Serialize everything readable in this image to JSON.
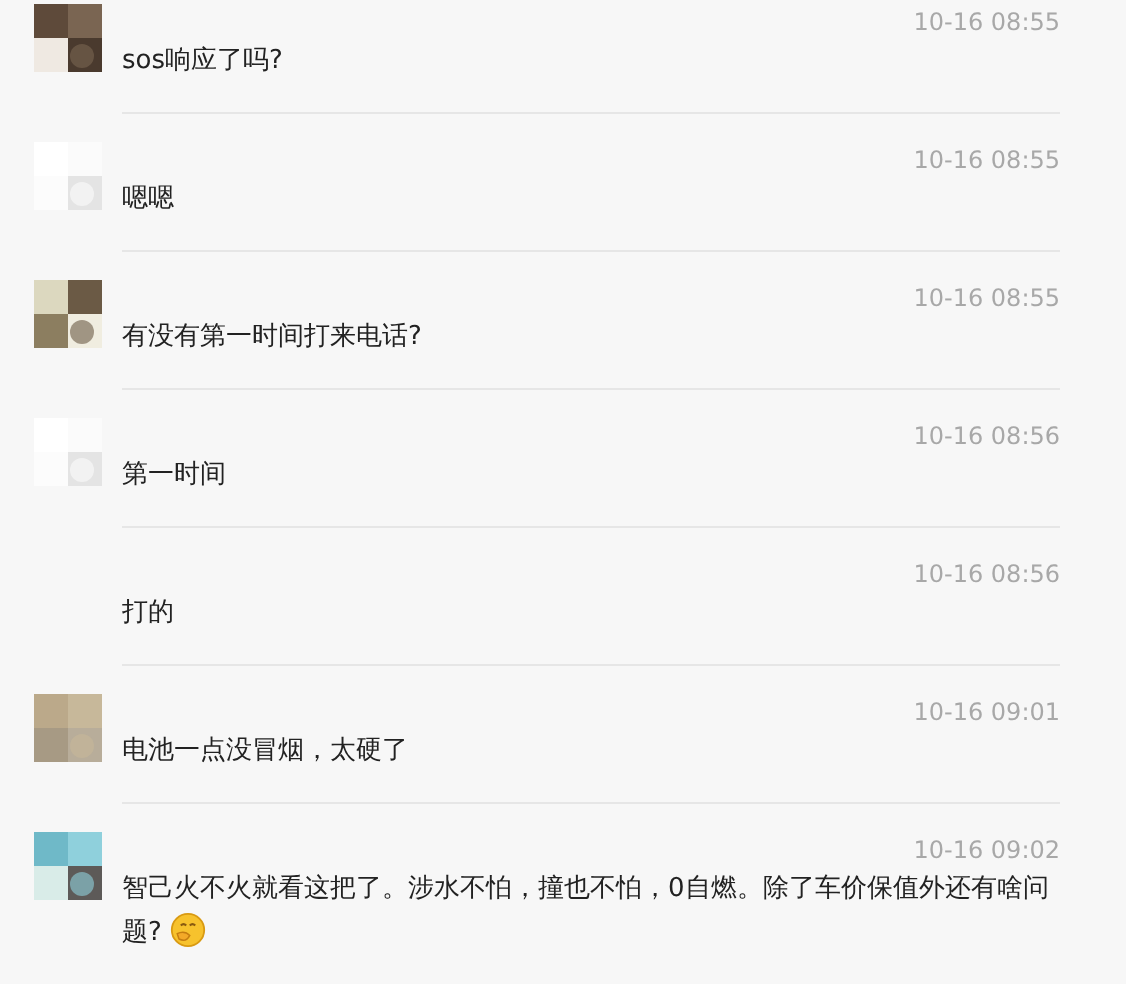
{
  "comments": [
    {
      "time": "10-16 08:55",
      "text": "sos响应了吗?",
      "emoji": false
    },
    {
      "time": "10-16 08:55",
      "text": "嗯嗯",
      "emoji": false
    },
    {
      "time": "10-16 08:55",
      "text": "有没有第一时间打来电话?",
      "emoji": false
    },
    {
      "time": "10-16 08:56",
      "text": "第一时间",
      "emoji": false
    },
    {
      "time": "10-16 08:56",
      "text": "打的",
      "emoji": false
    },
    {
      "time": "10-16 09:01",
      "text": "电池一点没冒烟，太硬了",
      "emoji": false
    },
    {
      "time": "10-16 09:02",
      "text": "智己火不火就看这把了。涉水不怕，撞也不怕，0自燃。除了车价保值外还有啥问题?",
      "emoji": true
    }
  ]
}
